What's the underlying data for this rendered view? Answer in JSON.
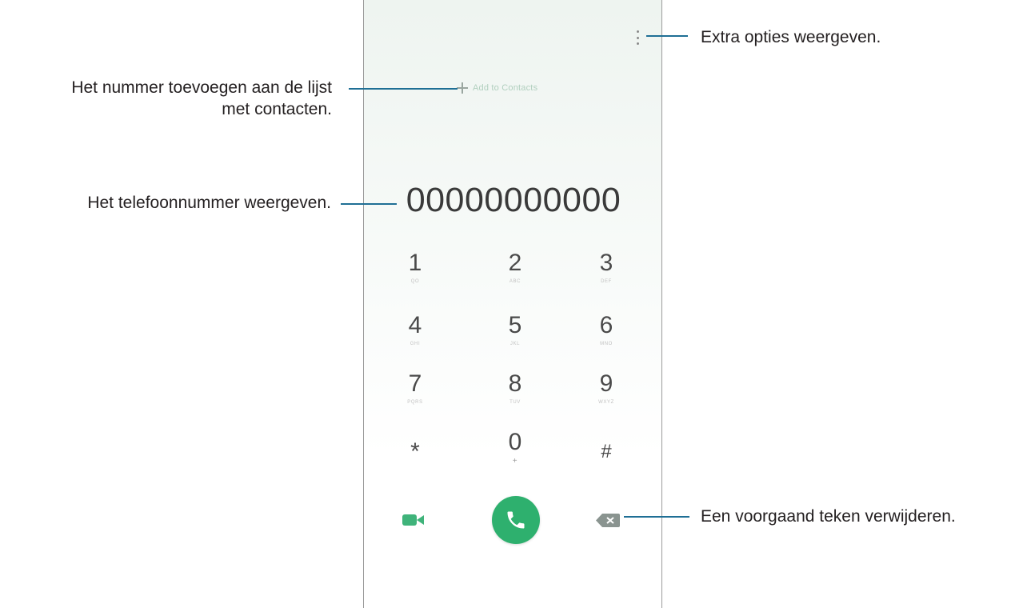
{
  "dialer": {
    "add_to_contacts_label": "Add to Contacts",
    "number": "00000000000",
    "keys": [
      {
        "digit": "1",
        "letters": "QO"
      },
      {
        "digit": "2",
        "letters": "ABC"
      },
      {
        "digit": "3",
        "letters": "DEF"
      },
      {
        "digit": "4",
        "letters": "GHI"
      },
      {
        "digit": "5",
        "letters": "JKL"
      },
      {
        "digit": "6",
        "letters": "MNO"
      },
      {
        "digit": "7",
        "letters": "PQRS"
      },
      {
        "digit": "8",
        "letters": "TUV"
      },
      {
        "digit": "9",
        "letters": "WXYZ"
      },
      {
        "digit": "*",
        "letters": ""
      },
      {
        "digit": "0",
        "letters": "+"
      },
      {
        "digit": "#",
        "letters": ""
      }
    ]
  },
  "callouts": {
    "options": "Extra opties weergeven.",
    "add_line1": "Het nummer toevoegen aan de lijst",
    "add_line2": "met contacten.",
    "number": "Het telefoonnummer weergeven.",
    "delete": "Een voorgaand teken verwijderen."
  },
  "colors": {
    "accent_green": "#2eb06e",
    "callout_line": "#1f6f95"
  }
}
